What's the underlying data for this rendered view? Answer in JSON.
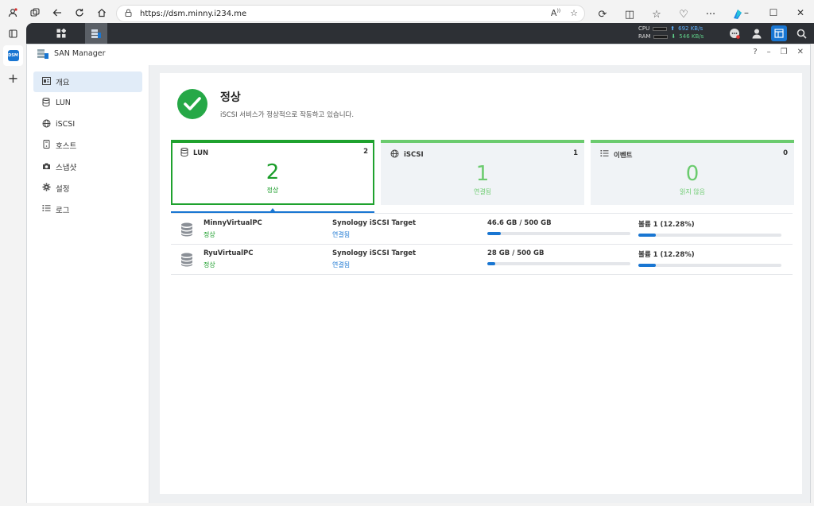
{
  "browser": {
    "url": "https://dsm.minny.i234.me"
  },
  "taskbar": {
    "cpu_label": "CPU",
    "ram_label": "RAM",
    "upload_speed": "692 KB/s",
    "download_speed": "546 KB/s"
  },
  "window": {
    "title": "SAN Manager",
    "help": "?",
    "minimize": "–",
    "restore": "❐",
    "close": "✕"
  },
  "sidebar": {
    "items": [
      {
        "label": "개요",
        "icon": "overview-icon",
        "active": true
      },
      {
        "label": "LUN",
        "icon": "database-icon",
        "active": false
      },
      {
        "label": "iSCSI",
        "icon": "globe-icon",
        "active": false
      },
      {
        "label": "호스트",
        "icon": "host-icon",
        "active": false
      },
      {
        "label": "스냅샷",
        "icon": "camera-icon",
        "active": false
      },
      {
        "label": "설정",
        "icon": "gear-icon",
        "active": false
      },
      {
        "label": "로그",
        "icon": "list-icon",
        "active": false
      }
    ]
  },
  "status": {
    "title": "정상",
    "description": "iSCSI 서비스가 정상적으로 작동하고 있습니다.",
    "color": "#26a847"
  },
  "cards": [
    {
      "title": "LUN",
      "count": "2",
      "big": "2",
      "sub": "정상"
    },
    {
      "title": "iSCSI",
      "count": "1",
      "big": "1",
      "sub": "연결됨"
    },
    {
      "title": "이벤트",
      "count": "0",
      "big": "0",
      "sub": "읽지 않음"
    }
  ],
  "lun_rows": [
    {
      "name": "MinnyVirtualPC",
      "name_status": "정상",
      "target": "Synology iSCSI Target",
      "target_status": "연결됨",
      "usage": "46.6 GB / 500 GB",
      "usage_fraction": 0.093,
      "volume": "볼륨 1 (12.28%)",
      "volume_fraction": 0.1228
    },
    {
      "name": "RyuVirtualPC",
      "name_status": "정상",
      "target": "Synology iSCSI Target",
      "target_status": "연결됨",
      "usage": "28 GB / 500 GB",
      "usage_fraction": 0.056,
      "volume": "볼륨 1 (12.28%)",
      "volume_fraction": 0.1228
    }
  ]
}
